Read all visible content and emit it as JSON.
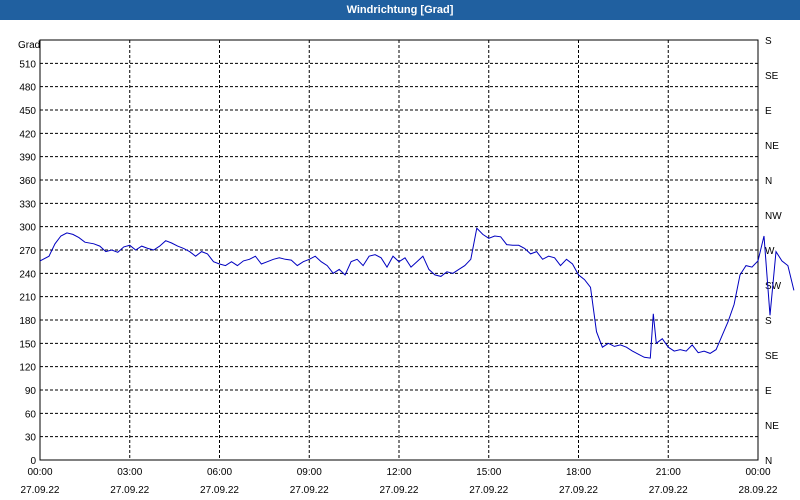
{
  "window": {
    "title": "Windrichtung [Grad]"
  },
  "chart_data": {
    "type": "line",
    "title": "Windrichtung [Grad]",
    "ylabel": "Grad",
    "ylim": [
      0,
      540
    ],
    "yticks": [
      0,
      30,
      60,
      90,
      120,
      150,
      180,
      210,
      240,
      270,
      300,
      330,
      360,
      390,
      420,
      450,
      480,
      510
    ],
    "right_ticks": [
      "N",
      "NE",
      "E",
      "SE",
      "S",
      "SW",
      "W",
      "NW",
      "N",
      "NE",
      "E",
      "SE",
      "S"
    ],
    "right_tick_values": [
      0,
      45,
      90,
      135,
      180,
      225,
      270,
      315,
      360,
      405,
      450,
      495,
      540
    ],
    "xlim": [
      0,
      24
    ],
    "xticks": [
      {
        "x": 0,
        "time": "00:00",
        "date": "27.09.22"
      },
      {
        "x": 3,
        "time": "03:00",
        "date": "27.09.22"
      },
      {
        "x": 6,
        "time": "06:00",
        "date": "27.09.22"
      },
      {
        "x": 9,
        "time": "09:00",
        "date": "27.09.22"
      },
      {
        "x": 12,
        "time": "12:00",
        "date": "27.09.22"
      },
      {
        "x": 15,
        "time": "15:00",
        "date": "27.09.22"
      },
      {
        "x": 18,
        "time": "18:00",
        "date": "27.09.22"
      },
      {
        "x": 21,
        "time": "21:00",
        "date": "27.09.22"
      },
      {
        "x": 24,
        "time": "00:00",
        "date": "28.09.22"
      }
    ],
    "grid": true,
    "series": [
      {
        "color": "#0000c0",
        "points": [
          [
            0.0,
            256
          ],
          [
            0.3,
            262
          ],
          [
            0.5,
            278
          ],
          [
            0.7,
            288
          ],
          [
            0.9,
            292
          ],
          [
            1.1,
            290
          ],
          [
            1.3,
            286
          ],
          [
            1.5,
            280
          ],
          [
            1.8,
            278
          ],
          [
            2.0,
            275
          ],
          [
            2.2,
            268
          ],
          [
            2.4,
            270
          ],
          [
            2.6,
            267
          ],
          [
            2.8,
            274
          ],
          [
            3.0,
            276
          ],
          [
            3.2,
            270
          ],
          [
            3.4,
            275
          ],
          [
            3.6,
            272
          ],
          [
            3.8,
            270
          ],
          [
            4.0,
            275
          ],
          [
            4.2,
            282
          ],
          [
            4.4,
            279
          ],
          [
            4.6,
            275
          ],
          [
            4.8,
            272
          ],
          [
            5.0,
            268
          ],
          [
            5.2,
            262
          ],
          [
            5.4,
            268
          ],
          [
            5.6,
            265
          ],
          [
            5.8,
            255
          ],
          [
            6.0,
            252
          ],
          [
            6.2,
            250
          ],
          [
            6.4,
            255
          ],
          [
            6.6,
            250
          ],
          [
            6.8,
            256
          ],
          [
            7.0,
            258
          ],
          [
            7.2,
            262
          ],
          [
            7.4,
            252
          ],
          [
            7.6,
            255
          ],
          [
            7.8,
            258
          ],
          [
            8.0,
            260
          ],
          [
            8.2,
            258
          ],
          [
            8.4,
            257
          ],
          [
            8.6,
            250
          ],
          [
            8.8,
            255
          ],
          [
            9.0,
            258
          ],
          [
            9.2,
            262
          ],
          [
            9.4,
            255
          ],
          [
            9.6,
            250
          ],
          [
            9.8,
            240
          ],
          [
            10.0,
            245
          ],
          [
            10.2,
            238
          ],
          [
            10.4,
            255
          ],
          [
            10.6,
            258
          ],
          [
            10.8,
            250
          ],
          [
            11.0,
            262
          ],
          [
            11.2,
            264
          ],
          [
            11.4,
            260
          ],
          [
            11.6,
            248
          ],
          [
            11.8,
            262
          ],
          [
            12.0,
            255
          ],
          [
            12.2,
            260
          ],
          [
            12.4,
            248
          ],
          [
            12.6,
            255
          ],
          [
            12.8,
            262
          ],
          [
            13.0,
            245
          ],
          [
            13.2,
            238
          ],
          [
            13.4,
            236
          ],
          [
            13.6,
            242
          ],
          [
            13.8,
            240
          ],
          [
            14.0,
            245
          ],
          [
            14.2,
            250
          ],
          [
            14.4,
            258
          ],
          [
            14.6,
            298
          ],
          [
            14.8,
            290
          ],
          [
            15.0,
            285
          ],
          [
            15.2,
            288
          ],
          [
            15.4,
            287
          ],
          [
            15.6,
            277
          ],
          [
            15.8,
            276
          ],
          [
            16.0,
            276
          ],
          [
            16.2,
            272
          ],
          [
            16.4,
            265
          ],
          [
            16.6,
            268
          ],
          [
            16.8,
            258
          ],
          [
            17.0,
            262
          ],
          [
            17.2,
            260
          ],
          [
            17.4,
            250
          ],
          [
            17.6,
            258
          ],
          [
            17.8,
            252
          ],
          [
            18.0,
            238
          ],
          [
            18.2,
            232
          ],
          [
            18.4,
            222
          ],
          [
            18.6,
            165
          ],
          [
            18.8,
            145
          ],
          [
            19.0,
            150
          ],
          [
            19.2,
            146
          ],
          [
            19.4,
            148
          ],
          [
            19.6,
            145
          ],
          [
            19.8,
            140
          ],
          [
            20.0,
            136
          ],
          [
            20.2,
            132
          ],
          [
            20.4,
            131
          ],
          [
            20.5,
            188
          ],
          [
            20.6,
            150
          ],
          [
            20.8,
            156
          ],
          [
            21.0,
            145
          ],
          [
            21.2,
            140
          ],
          [
            21.4,
            142
          ],
          [
            21.6,
            140
          ],
          [
            21.8,
            148
          ],
          [
            22.0,
            138
          ],
          [
            22.2,
            140
          ],
          [
            22.4,
            137
          ],
          [
            22.6,
            142
          ],
          [
            22.8,
            160
          ],
          [
            23.0,
            178
          ],
          [
            23.2,
            200
          ],
          [
            23.4,
            238
          ],
          [
            23.6,
            250
          ],
          [
            23.8,
            248
          ],
          [
            24.0,
            256
          ],
          [
            24.2,
            288
          ],
          [
            24.4,
            186
          ],
          [
            24.6,
            268
          ],
          [
            24.8,
            256
          ],
          [
            25.0,
            250
          ],
          [
            25.2,
            218
          ]
        ]
      }
    ]
  }
}
